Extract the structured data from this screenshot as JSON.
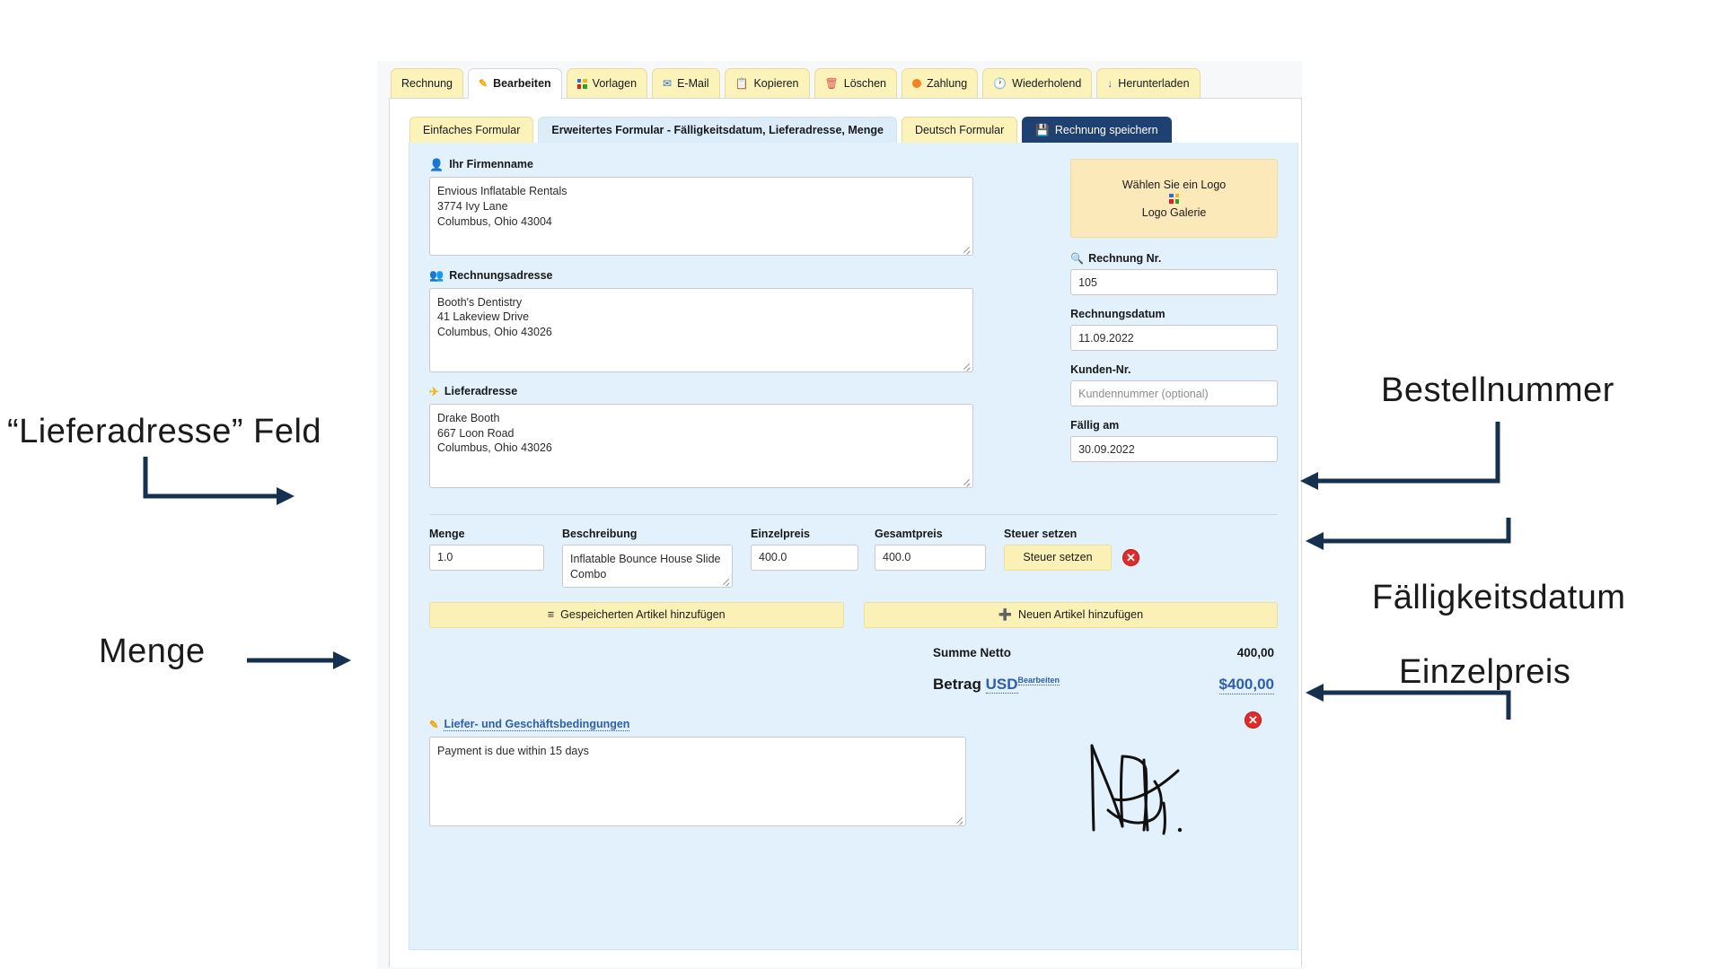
{
  "window": {
    "tabs": [
      {
        "label": "Rechnung",
        "icon": "none",
        "active": false
      },
      {
        "label": "Bearbeiten",
        "icon": "pencil-icon",
        "active": true
      },
      {
        "label": "Vorlagen",
        "icon": "grid-icon",
        "active": false
      },
      {
        "label": "E-Mail",
        "icon": "envelope-icon",
        "active": false
      },
      {
        "label": "Kopieren",
        "icon": "copy-icon",
        "active": false
      },
      {
        "label": "Löschen",
        "icon": "trash-icon",
        "active": false
      },
      {
        "label": "Zahlung",
        "icon": "dot-icon",
        "active": false
      },
      {
        "label": "Wiederholend",
        "icon": "clock-icon",
        "active": false
      },
      {
        "label": "Herunterladen",
        "icon": "download-icon",
        "active": false
      }
    ],
    "subtabs": [
      {
        "label": "Einfaches Formular",
        "state": "normal",
        "icon": "none"
      },
      {
        "label": "Erweitertes Formular - Fälligkeitsdatum, Lieferadresse, Menge",
        "state": "selected",
        "icon": "none"
      },
      {
        "label": "Deutsch Formular",
        "state": "normal",
        "icon": "none"
      },
      {
        "label": "Rechnung speichern",
        "state": "save",
        "icon": "save-icon"
      }
    ]
  },
  "form": {
    "company": {
      "label": "Ihr Firmenname",
      "icon": "person-icon",
      "value": "Envious Inflatable Rentals\n3774 Ivy Lane\nColumbus, Ohio 43004"
    },
    "billing": {
      "label": "Rechnungsadresse",
      "icon": "people-icon",
      "value": "Booth's Dentistry\n41 Lakeview Drive\nColumbus, Ohio 43026"
    },
    "shipping": {
      "label": "Lieferadresse",
      "icon": "plane-icon",
      "value": "Drake Booth\n667 Loon Road\nColumbus, Ohio 43026"
    },
    "logo": {
      "title": "Wählen Sie ein Logo",
      "gallery_label": "Logo Galerie",
      "icon": "four-square-icon"
    },
    "invoice_no": {
      "label": "Rechnung Nr.",
      "icon": "magnifier-icon",
      "value": "105"
    },
    "invoice_date": {
      "label": "Rechnungsdatum",
      "value": "11.09.2022"
    },
    "customer_no": {
      "label": "Kunden-Nr.",
      "value": "",
      "placeholder": "Kundennummer (optional)"
    },
    "due_date": {
      "label": "Fällig am",
      "value": "30.09.2022"
    },
    "items_columns": [
      "Menge",
      "Beschreibung",
      "Einzelpreis",
      "Gesamtpreis",
      "Steuer setzen"
    ],
    "items": [
      {
        "menge": "1.0",
        "beschreibung": "Inflatable Bounce House Slide Combo",
        "einzelpreis": "400.0",
        "gesamtpreis": "400.0",
        "steuer_button": "Steuer setzen",
        "delete_icon": "delete-circle-icon"
      }
    ],
    "add_saved_item_button": "Gespeicherten Artikel hinzufügen",
    "add_new_item_button": "Neuen Artikel hinzufügen",
    "totals": {
      "net_label": "Summe Netto",
      "net_value": "400,00",
      "amount_label": "Betrag",
      "currency": "USD",
      "currency_edit": "Bearbeiten",
      "amount_value": "$400,00"
    },
    "terms": {
      "label": "Liefer- und Geschäftsbedingungen",
      "icon": "pencil-icon",
      "value": "Payment is due within 15 days",
      "delete_icon": "delete-circle-icon"
    }
  },
  "annotations": {
    "color": "#16304f",
    "items": [
      {
        "id": "shipping-address-field",
        "text": "“Lieferadresse” Feld"
      },
      {
        "id": "quantity",
        "text": "Menge"
      },
      {
        "id": "order-number",
        "text": "Bestellnummer"
      },
      {
        "id": "due-date",
        "text": "Fälligkeitsdatum"
      },
      {
        "id": "unit-price",
        "text": "Einzelpreis"
      }
    ]
  }
}
